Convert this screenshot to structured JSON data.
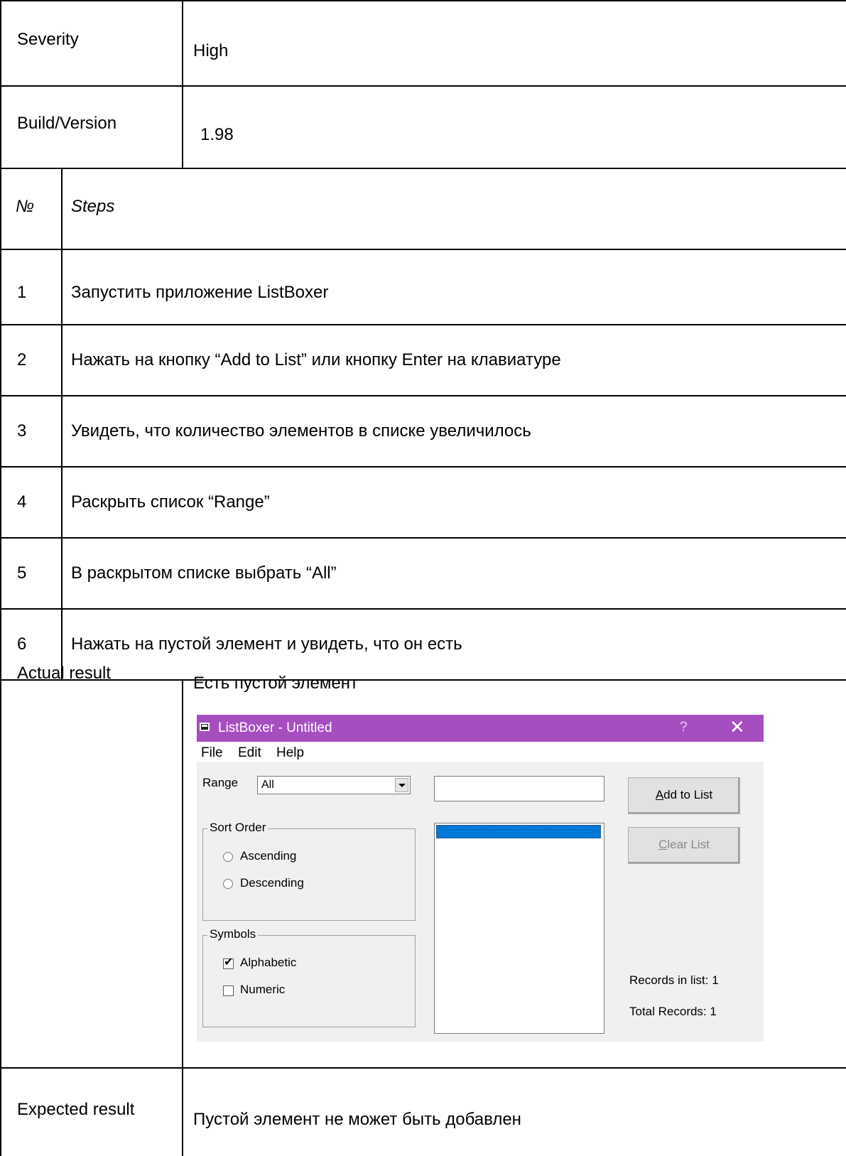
{
  "severity": {
    "label": "Severity",
    "value": "High"
  },
  "build": {
    "label": "Build/Version",
    "value": "1.98"
  },
  "steps_header": {
    "num": "№",
    "title": "Steps"
  },
  "steps": [
    {
      "num": "1",
      "text": "Запустить приложение ListBoxer"
    },
    {
      "num": "2",
      "text": "Нажать на кнопку “Add to List” или кнопку Enter на клавиатуре"
    },
    {
      "num": "3",
      "text": "Увидеть, что количество элементов в списке увеличилось"
    },
    {
      "num": "4",
      "text": "Раскрыть список “Range”"
    },
    {
      "num": "5",
      "text": "В раскрытом списке выбрать “All”"
    },
    {
      "num": "6",
      "text": "Нажать на пустой элемент и увидеть, что он есть"
    }
  ],
  "actual": {
    "label": "Actual result",
    "value": "Есть пустой элемент"
  },
  "expected": {
    "label": "Expected result",
    "value": "Пустой элемент не может быть добавлен"
  },
  "screenshot": {
    "window_title": "ListBoxer - Untitled",
    "help_glyph": "?",
    "close_glyph": "✕",
    "titlebar_color": "#a64ec0",
    "menu": [
      "File",
      "Edit",
      "Help"
    ],
    "range_label": "Range",
    "range_value": "All",
    "text_input_value": "",
    "add_button": {
      "prefix": "",
      "accel": "A",
      "rest": "dd to List"
    },
    "clear_button": {
      "prefix": "",
      "accel": "C",
      "rest": "lear List",
      "disabled": true
    },
    "sort_order": {
      "title": "Sort Order",
      "options": [
        {
          "label": "Ascending",
          "selected": false
        },
        {
          "label": "Descending",
          "selected": false
        }
      ]
    },
    "symbols": {
      "title": "Symbols",
      "options": [
        {
          "label": "Alphabetic",
          "checked": true
        },
        {
          "label": "Numeric",
          "checked": false
        }
      ]
    },
    "list_items": [
      ""
    ],
    "selected_item_color": "#0078d7",
    "records_in_list": "Records in list: 1",
    "total_records": "Total Records: 1"
  }
}
